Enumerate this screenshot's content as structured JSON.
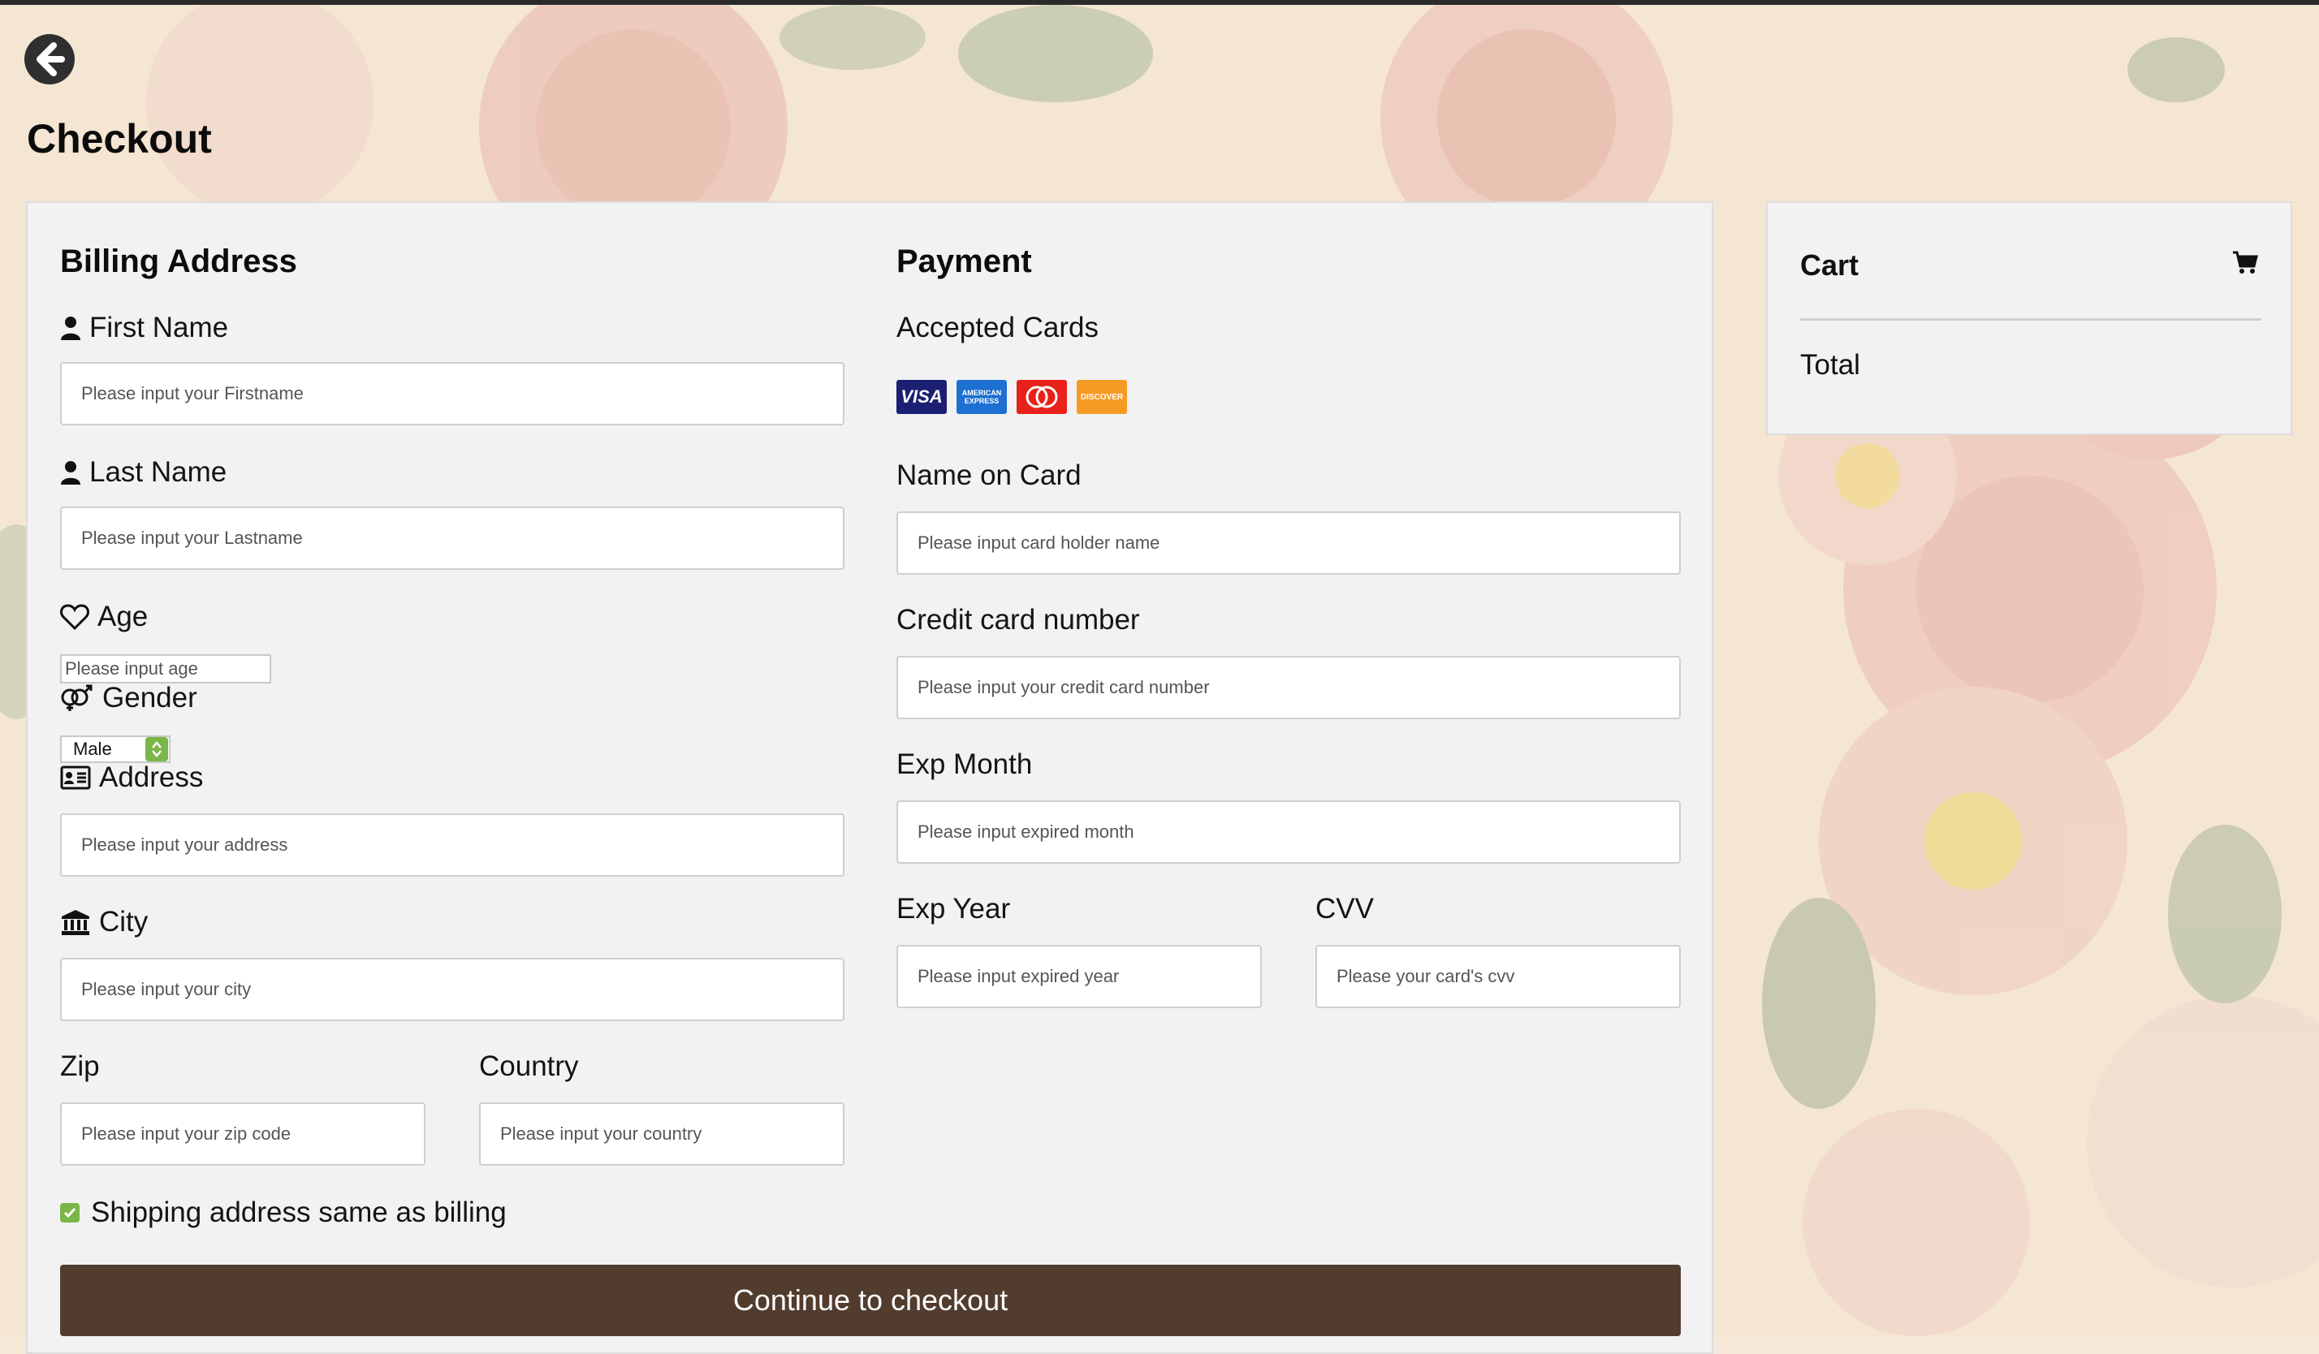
{
  "page": {
    "title": "Checkout"
  },
  "billing": {
    "heading": "Billing Address",
    "first_name": {
      "label": "First Name",
      "placeholder": "Please input your Firstname"
    },
    "last_name": {
      "label": "Last Name",
      "placeholder": "Please input your Lastname"
    },
    "age": {
      "label": "Age",
      "placeholder": "Please input age"
    },
    "gender": {
      "label": "Gender",
      "selected": "Male"
    },
    "address": {
      "label": "Address",
      "placeholder": "Please input your address"
    },
    "city": {
      "label": "City",
      "placeholder": "Please input your city"
    },
    "zip": {
      "label": "Zip",
      "placeholder": "Please input your zip code"
    },
    "country": {
      "label": "Country",
      "placeholder": "Please input your country"
    }
  },
  "payment": {
    "heading": "Payment",
    "accepted_cards": {
      "label": "Accepted Cards",
      "cards": [
        {
          "name": "visa",
          "text": "VISA",
          "color": "#1a1f71"
        },
        {
          "name": "amex",
          "text": "AMERICAN EXPRESS",
          "color": "#1d6fd1"
        },
        {
          "name": "mastercard",
          "text": "mastercard",
          "color": "#e8211a"
        },
        {
          "name": "discover",
          "text": "DISCOVER",
          "color": "#f59a23"
        }
      ]
    },
    "name_on_card": {
      "label": "Name on Card",
      "placeholder": "Please input card holder name"
    },
    "card_number": {
      "label": "Credit card number",
      "placeholder": "Please input your credit card number"
    },
    "exp_month": {
      "label": "Exp Month",
      "placeholder": "Please input expired month"
    },
    "exp_year": {
      "label": "Exp Year",
      "placeholder": "Please input expired year"
    },
    "cvv": {
      "label": "CVV",
      "placeholder": "Please your card's cvv"
    }
  },
  "shipping_same": {
    "label": "Shipping address same as billing",
    "checked": true
  },
  "submit": {
    "label": "Continue to checkout"
  },
  "cart": {
    "title": "Cart",
    "total_label": "Total"
  },
  "colors": {
    "button": "#523c2e",
    "checkbox": "#7ab648",
    "panel": "#f2f2f2"
  },
  "icons": [
    "back-arrow-icon",
    "user-icon",
    "heart-icon",
    "gender-icon",
    "address-card-icon",
    "bank-icon",
    "shopping-cart-icon",
    "checkmark-icon"
  ]
}
